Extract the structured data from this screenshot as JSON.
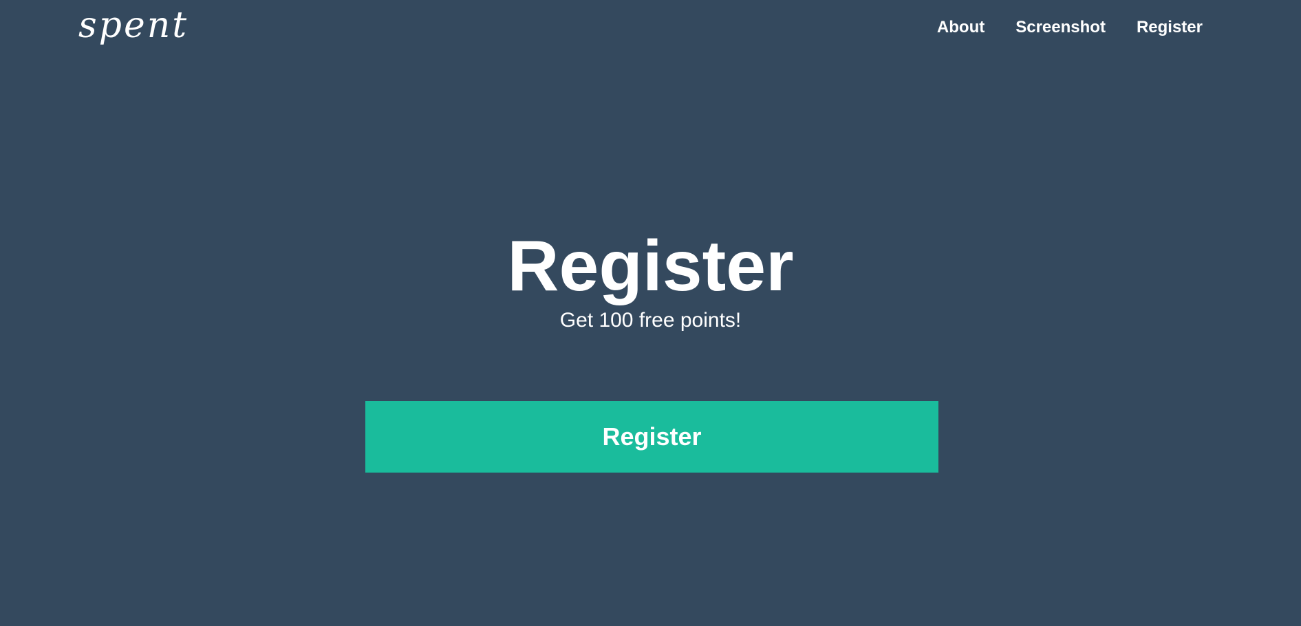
{
  "header": {
    "logo_text": "spent",
    "nav": [
      {
        "label": "About"
      },
      {
        "label": "Screenshot"
      },
      {
        "label": "Register"
      }
    ]
  },
  "hero": {
    "title": "Register",
    "subtitle": "Get 100 free points!",
    "button_label": "Register"
  },
  "colors": {
    "background": "#34495e",
    "accent": "#1abc9c",
    "text": "#ffffff"
  }
}
